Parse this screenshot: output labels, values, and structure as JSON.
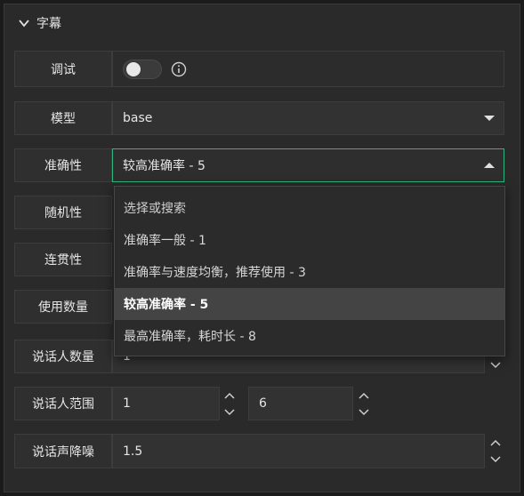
{
  "section": {
    "title": "字幕"
  },
  "rows": {
    "debug": {
      "label": "调试"
    },
    "model": {
      "label": "模型",
      "value": "base"
    },
    "accuracy": {
      "label": "准确性",
      "value": "较高准确率 - 5"
    },
    "randomness": {
      "label": "随机性"
    },
    "coherence": {
      "label": "连贯性"
    },
    "usage_count": {
      "label": "使用数量"
    },
    "speakers": {
      "label": "说话人数量",
      "value": "1"
    },
    "speaker_range": {
      "label": "说话人范围",
      "min": "1",
      "max": "6"
    },
    "denoise": {
      "label": "说话声降噪",
      "value": "1.5"
    }
  },
  "dropdown": {
    "search_placeholder": "选择或搜索",
    "options": [
      "准确率一般 - 1",
      "准确率与速度均衡，推荐使用 - 3",
      "较高准确率 - 5",
      "最高准确率，耗时长 - 8"
    ],
    "selected_index": 2
  },
  "colors": {
    "focus": "#2fb57f",
    "selected_bg": "#444444"
  }
}
